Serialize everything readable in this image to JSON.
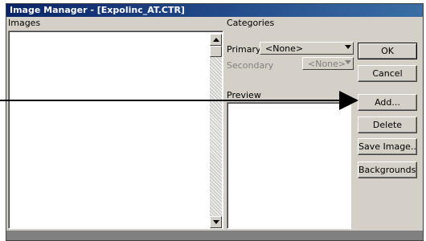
{
  "window": {
    "title": "Image Manager - [Expolinc_AT.CTR]"
  },
  "images": {
    "label": "Images"
  },
  "categories": {
    "label": "Categories",
    "primary": {
      "label": "Primary",
      "value": "<None>"
    },
    "secondary": {
      "label": "Secondary",
      "value": "<None>",
      "enabled": false
    }
  },
  "preview": {
    "label": "Preview"
  },
  "buttons": {
    "ok": "OK",
    "cancel": "Cancel",
    "add": "Add...",
    "delete": "Delete",
    "save_image": "Save Image...",
    "backgrounds": "Backgrounds..."
  },
  "annotation": {
    "color": "#000000"
  }
}
